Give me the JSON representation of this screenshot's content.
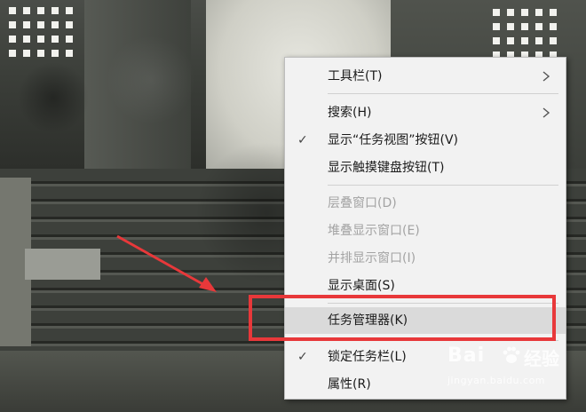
{
  "context_menu": {
    "items": [
      {
        "label": "工具栏(T)",
        "submenu": true
      },
      {
        "label": "搜索(H)",
        "submenu": true
      },
      {
        "label": "显示“任务视图”按钮(V)",
        "checked": true
      },
      {
        "label": "显示触摸键盘按钮(T)"
      },
      {
        "label": "层叠窗口(D)",
        "disabled": true
      },
      {
        "label": "堆叠显示窗口(E)",
        "disabled": true
      },
      {
        "label": "并排显示窗口(I)",
        "disabled": true
      },
      {
        "label": "显示桌面(S)"
      },
      {
        "label": "任务管理器(K)",
        "hovered": true
      },
      {
        "label": "锁定任务栏(L)",
        "checked": true
      },
      {
        "label": "属性(R)"
      }
    ],
    "check_glyph": "✓"
  },
  "annotation": {
    "highlight_color": "#e8383a",
    "arrow_color": "#e8383a",
    "highlighted_item": "任务管理器(K)"
  },
  "watermark": {
    "logo_text": "Bai",
    "brand_text": "经验",
    "url": "jingyan.baidu.com"
  },
  "colors": {
    "menu_bg": "#f2f2f2",
    "hover_bg": "#dadada",
    "disabled_text": "#a3a3a3"
  }
}
